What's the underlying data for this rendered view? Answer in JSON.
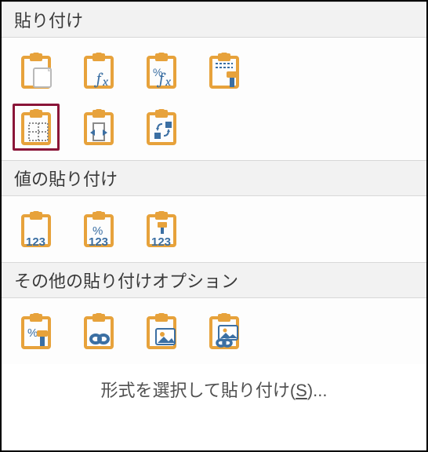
{
  "colors": {
    "clip": "#E7A23B",
    "accent": "#3B6FA3",
    "grid": "#7d7d7d"
  },
  "sections": {
    "paste": {
      "title": "貼り付け",
      "items": [
        {
          "name": "paste",
          "selected": false
        },
        {
          "name": "paste-formulas",
          "selected": false
        },
        {
          "name": "paste-formulas-number-formatting",
          "selected": false
        },
        {
          "name": "paste-keep-source-formatting",
          "selected": false
        },
        {
          "name": "paste-no-borders",
          "selected": true
        },
        {
          "name": "paste-keep-column-widths",
          "selected": false
        },
        {
          "name": "paste-transpose",
          "selected": false
        }
      ]
    },
    "values": {
      "title": "値の貼り付け",
      "items": [
        {
          "name": "paste-values",
          "selected": false
        },
        {
          "name": "paste-values-number-formatting",
          "selected": false
        },
        {
          "name": "paste-values-source-formatting",
          "selected": false
        }
      ]
    },
    "other": {
      "title": "その他の貼り付けオプション",
      "items": [
        {
          "name": "paste-formatting",
          "selected": false
        },
        {
          "name": "paste-link",
          "selected": false
        },
        {
          "name": "paste-picture",
          "selected": false
        },
        {
          "name": "paste-linked-picture",
          "selected": false
        }
      ]
    }
  },
  "footer": {
    "label_pre": "形式を選択して貼り付け(",
    "shortcut": "S",
    "label_post": ")..."
  }
}
